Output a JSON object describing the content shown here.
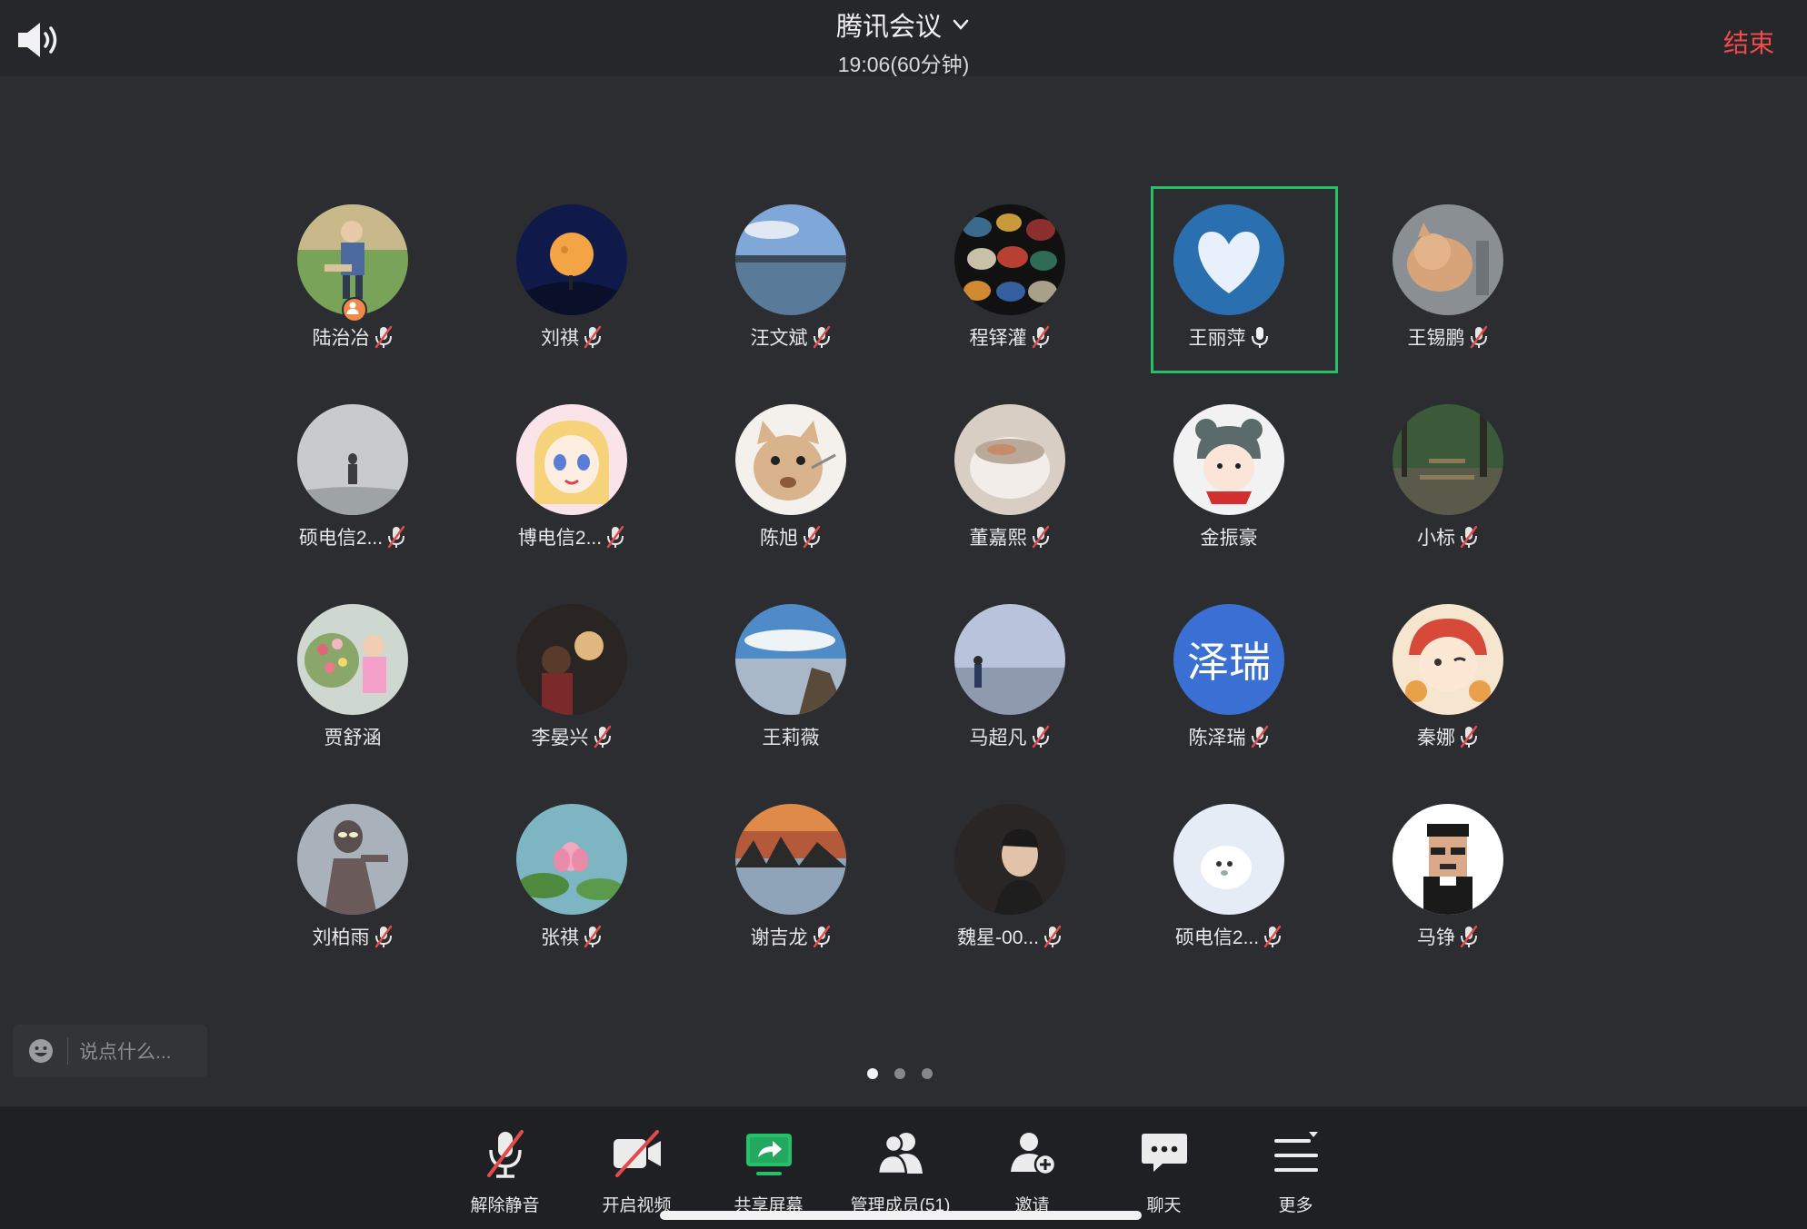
{
  "header": {
    "title": "腾讯会议",
    "subtitle": "19:06(60分钟)",
    "end_label": "结束"
  },
  "participants": [
    {
      "name": "陆治冶",
      "mic": "muted",
      "host": true,
      "avatar": "photo-child-bike"
    },
    {
      "name": "刘祺",
      "mic": "muted",
      "avatar": "photo-moon"
    },
    {
      "name": "汪文斌",
      "mic": "muted",
      "avatar": "photo-lake"
    },
    {
      "name": "程铎灌",
      "mic": "muted",
      "avatar": "photo-pebbles"
    },
    {
      "name": "王丽萍",
      "mic": "on",
      "active": true,
      "avatar": "photo-heart-cloud"
    },
    {
      "name": "王锡鹏",
      "mic": "muted",
      "avatar": "photo-cat"
    },
    {
      "name": "硕电信2...",
      "mic": "muted",
      "avatar": "photo-fog-figure"
    },
    {
      "name": "博电信2...",
      "mic": "muted",
      "avatar": "anime-girl"
    },
    {
      "name": "陈旭",
      "mic": "muted",
      "avatar": "cartoon-cat"
    },
    {
      "name": "董嘉熙",
      "mic": "muted",
      "avatar": "photo-cup"
    },
    {
      "name": "金振豪",
      "mic": "none",
      "avatar": "cartoon-bear-girl"
    },
    {
      "name": "小标",
      "mic": "muted",
      "avatar": "photo-forest"
    },
    {
      "name": "贾舒涵",
      "mic": "none",
      "avatar": "photo-flowers-girl"
    },
    {
      "name": "李晏兴",
      "mic": "muted",
      "avatar": "photo-child-lamp"
    },
    {
      "name": "王莉薇",
      "mic": "none",
      "avatar": "photo-sea-cliff"
    },
    {
      "name": "马超凡",
      "mic": "muted",
      "avatar": "photo-beach"
    },
    {
      "name": "陈泽瑞",
      "mic": "muted",
      "avatar_text": "泽瑞"
    },
    {
      "name": "秦娜",
      "mic": "muted",
      "avatar": "cartoon-girl"
    },
    {
      "name": "刘柏雨",
      "mic": "muted",
      "avatar": "photo-ultraman"
    },
    {
      "name": "张祺",
      "mic": "muted",
      "avatar": "photo-lotus"
    },
    {
      "name": "谢吉龙",
      "mic": "muted",
      "avatar": "photo-sunset-snow"
    },
    {
      "name": "魏星-00...",
      "mic": "muted",
      "avatar": "photo-young-man"
    },
    {
      "name": "硕电信2...",
      "mic": "muted",
      "avatar": "cartoon-seal"
    },
    {
      "name": "马铮",
      "mic": "muted",
      "avatar": "pixel-man"
    }
  ],
  "chat_input": {
    "placeholder": "说点什么..."
  },
  "pager": {
    "pages": 3,
    "current": 1
  },
  "toolbar": [
    {
      "id": "unmute",
      "label": "解除静音",
      "icon": "mic-muted-icon"
    },
    {
      "id": "video",
      "label": "开启视频",
      "icon": "video-off-icon"
    },
    {
      "id": "share",
      "label": "共享屏幕",
      "icon": "share-screen-icon",
      "color": "#25c06a"
    },
    {
      "id": "members",
      "label": "管理成员(51)",
      "icon": "members-icon"
    },
    {
      "id": "invite",
      "label": "邀请",
      "icon": "invite-icon"
    },
    {
      "id": "chat",
      "label": "聊天",
      "icon": "chat-icon"
    },
    {
      "id": "more",
      "label": "更多",
      "icon": "more-icon"
    }
  ],
  "colors": {
    "accent_green": "#25c06a",
    "end_red": "#ef4b4b",
    "muted_red": "#e24b4b"
  }
}
